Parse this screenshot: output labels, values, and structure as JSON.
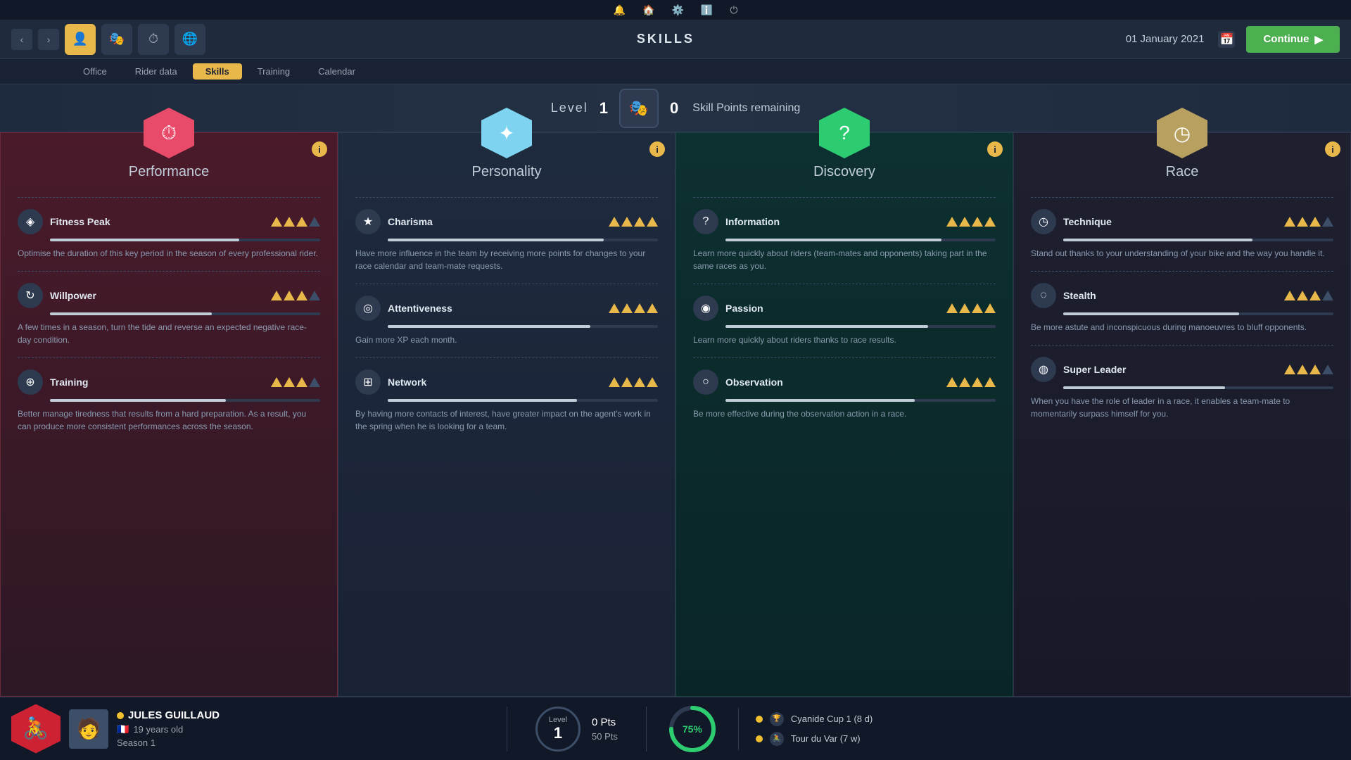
{
  "topbar": {
    "icons": [
      "🔔",
      "🏠",
      "⚙️",
      "ℹ️",
      "⏻"
    ]
  },
  "navbar": {
    "title": "SKILLS",
    "date": "01 January 2021",
    "continue_label": "Continue",
    "nav_icons": [
      {
        "icon": "👤",
        "active": true
      },
      {
        "icon": "🎭",
        "active": false
      },
      {
        "icon": "⏱",
        "active": false
      },
      {
        "icon": "🌐",
        "active": false
      }
    ]
  },
  "subnav": {
    "items": [
      "Office",
      "Rider data",
      "Skills",
      "Training",
      "Calendar"
    ],
    "active": "Skills"
  },
  "level_banner": {
    "label": "Level",
    "level": "1",
    "skill_points_num": "0",
    "skill_points_label": "Skill Points remaining"
  },
  "cards": [
    {
      "id": "performance",
      "title": "Performance",
      "hex_color": "performance",
      "skills": [
        {
          "name": "Fitness Peak",
          "icon": "◈",
          "stars": 3,
          "max_stars": 4,
          "bar": 70,
          "desc": "Optimise the duration of this key period in the season of every professional rider."
        },
        {
          "name": "Willpower",
          "icon": "↻",
          "stars": 3,
          "max_stars": 4,
          "bar": 60,
          "desc": "A few times in a season, turn the tide and reverse an expected negative race-day condition."
        },
        {
          "name": "Training",
          "icon": "⊕",
          "stars": 3,
          "max_stars": 4,
          "bar": 65,
          "desc": "Better manage tiredness that results from a hard preparation. As a result, you can produce more consistent performances across the season."
        }
      ]
    },
    {
      "id": "personality",
      "title": "Personality",
      "hex_color": "personality",
      "skills": [
        {
          "name": "Charisma",
          "icon": "★",
          "stars": 4,
          "max_stars": 4,
          "bar": 80,
          "desc": "Have more influence in the team by receiving more points for changes to your race calendar and team-mate requests."
        },
        {
          "name": "Attentiveness",
          "icon": "◎",
          "stars": 4,
          "max_stars": 4,
          "bar": 75,
          "desc": "Gain more XP each month."
        },
        {
          "name": "Network",
          "icon": "⊞",
          "stars": 4,
          "max_stars": 4,
          "bar": 70,
          "desc": "By having more contacts of interest, have greater impact on the agent's work in the spring when he is looking for a team."
        }
      ]
    },
    {
      "id": "discovery",
      "title": "Discovery",
      "hex_color": "discovery",
      "skills": [
        {
          "name": "Information",
          "icon": "?",
          "stars": 4,
          "max_stars": 4,
          "bar": 80,
          "desc": "Learn more quickly about riders (team-mates and opponents) taking part in the same races as you."
        },
        {
          "name": "Passion",
          "icon": "◉",
          "stars": 4,
          "max_stars": 4,
          "bar": 75,
          "desc": "Learn more quickly about riders thanks to race results."
        },
        {
          "name": "Observation",
          "icon": "○",
          "stars": 4,
          "max_stars": 4,
          "bar": 70,
          "desc": "Be more effective during the observation action in a race."
        }
      ]
    },
    {
      "id": "race",
      "title": "Race",
      "hex_color": "race",
      "skills": [
        {
          "name": "Technique",
          "icon": "◷",
          "stars": 3,
          "max_stars": 4,
          "bar": 70,
          "desc": "Stand out thanks to your understanding of your bike and the way you handle it."
        },
        {
          "name": "Stealth",
          "icon": "◌",
          "stars": 3,
          "max_stars": 4,
          "bar": 65,
          "desc": "Be more astute and inconspicuous during manoeuvres to bluff opponents."
        },
        {
          "name": "Super Leader",
          "icon": "◍",
          "stars": 3,
          "max_stars": 4,
          "bar": 60,
          "desc": "When you have the role of leader in a race, it enables a team-mate to momentarily surpass himself for you."
        }
      ]
    }
  ],
  "bottom": {
    "player": {
      "name": "JULES GUILLAUD",
      "dot_color": "#f0c030",
      "age": "19 years old",
      "flag": "🇫🇷",
      "season": "Season 1"
    },
    "level": {
      "label": "Level",
      "value": "1",
      "pts_current": "0 Pts",
      "pts_total": "50 Pts"
    },
    "progress": {
      "percent": 75,
      "label": "75%"
    },
    "races": [
      {
        "icon": "🏆",
        "name": "Cyanide Cup 1 (8 d)"
      },
      {
        "icon": "🚴",
        "name": "Tour du Var (7 w)"
      }
    ]
  }
}
